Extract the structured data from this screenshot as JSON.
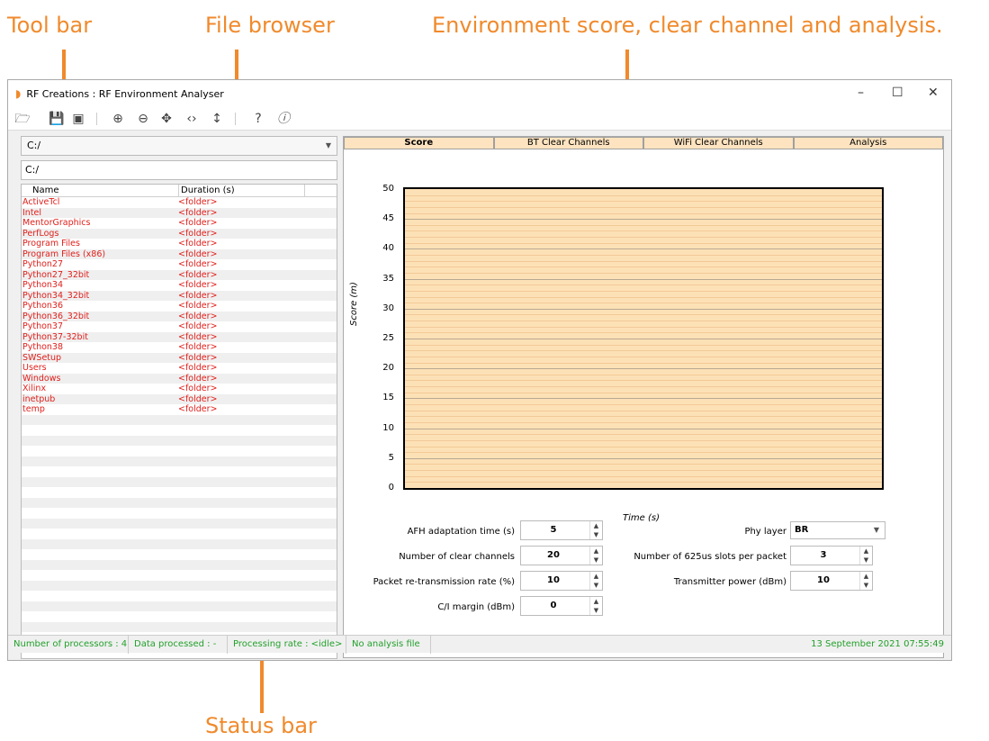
{
  "annotations": {
    "toolbar": "Tool bar",
    "file_browser": "File browser",
    "env": "Environment score, clear channel and analysis.",
    "status": "Status bar"
  },
  "window": {
    "title": "RF Creations : RF Environment Analyser",
    "minimize": "–",
    "maximize": "☐",
    "close": "✕"
  },
  "toolbar": {
    "icons": [
      "open-folder-icon",
      "save-icon",
      "camera-icon",
      "zoom-in-icon",
      "zoom-out-icon",
      "pan-icon",
      "horizontal-arrows-icon",
      "vertical-arrows-icon",
      "help-icon",
      "info-icon"
    ]
  },
  "browser": {
    "drive": "C:/",
    "path": "C:/",
    "col_name": "Name",
    "col_duration": "Duration (s)",
    "rows": [
      {
        "name": "ActiveTcl",
        "duration": "<folder>"
      },
      {
        "name": "Intel",
        "duration": "<folder>"
      },
      {
        "name": "MentorGraphics",
        "duration": "<folder>"
      },
      {
        "name": "PerfLogs",
        "duration": "<folder>"
      },
      {
        "name": "Program Files",
        "duration": "<folder>"
      },
      {
        "name": "Program Files (x86)",
        "duration": "<folder>"
      },
      {
        "name": "Python27",
        "duration": "<folder>"
      },
      {
        "name": "Python27_32bit",
        "duration": "<folder>"
      },
      {
        "name": "Python34",
        "duration": "<folder>"
      },
      {
        "name": "Python34_32bit",
        "duration": "<folder>"
      },
      {
        "name": "Python36",
        "duration": "<folder>"
      },
      {
        "name": "Python36_32bit",
        "duration": "<folder>"
      },
      {
        "name": "Python37",
        "duration": "<folder>"
      },
      {
        "name": "Python37-32bit",
        "duration": "<folder>"
      },
      {
        "name": "Python38",
        "duration": "<folder>"
      },
      {
        "name": "SWSetup",
        "duration": "<folder>"
      },
      {
        "name": "Users",
        "duration": "<folder>"
      },
      {
        "name": "Windows",
        "duration": "<folder>"
      },
      {
        "name": "Xilinx",
        "duration": "<folder>"
      },
      {
        "name": "inetpub",
        "duration": "<folder>"
      },
      {
        "name": "temp",
        "duration": "<folder>"
      }
    ]
  },
  "tabs": [
    "Score",
    "BT Clear Channels",
    "WiFi Clear Channels",
    "Analysis"
  ],
  "chart": {
    "ylabel": "Score (m)",
    "xlabel": "Time (s)",
    "yticks": [
      "50",
      "45",
      "40",
      "35",
      "30",
      "25",
      "20",
      "15",
      "10",
      "5",
      "0"
    ],
    "ylim": [
      0,
      50
    ],
    "fill_color": "#fde1b6"
  },
  "params": {
    "afh_label": "AFH adaptation time (s)",
    "afh_value": "5",
    "clear_label": "Number of clear channels",
    "clear_value": "20",
    "retx_label": "Packet re-transmission rate (%)",
    "retx_value": "10",
    "ci_label": "C/I margin (dBm)",
    "ci_value": "0",
    "phy_label": "Phy layer",
    "phy_value": "BR",
    "slots_label": "Number of 625us slots per packet",
    "slots_value": "3",
    "tx_label": "Transmitter power (dBm)",
    "tx_value": "10"
  },
  "status": {
    "processors": "Number of processors : 4",
    "data": "Data processed : -",
    "rate": "Processing rate : <idle>",
    "file": "No analysis file",
    "datetime": "13 September 2021 07:55:49"
  }
}
